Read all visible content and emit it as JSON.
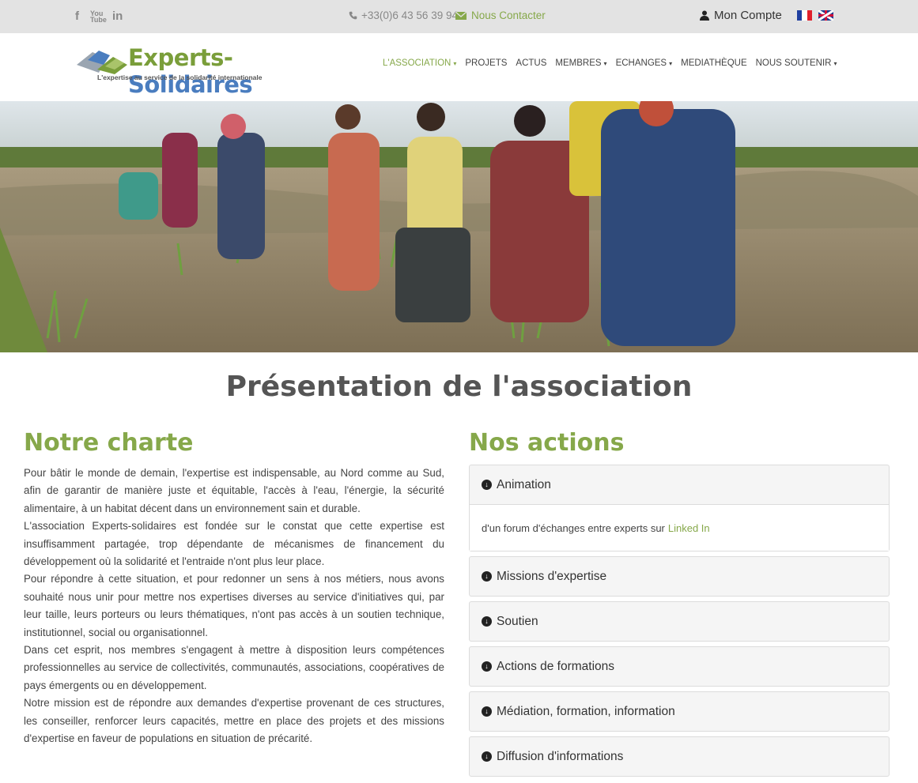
{
  "topbar": {
    "social": [
      {
        "icon": "facebook-icon",
        "glyph": "f"
      },
      {
        "icon": "youtube-icon",
        "glyph": "You Tube"
      },
      {
        "icon": "linkedin-icon",
        "glyph": "in"
      }
    ],
    "phone_icon": "phone-icon",
    "phone": "+33(0)6 43 56 39 94",
    "contact_icon": "envelope-icon",
    "contact": "Nous Contacter",
    "account_icon": "user-icon",
    "account": "Mon Compte",
    "flags": [
      "flag-fr-icon",
      "flag-uk-icon"
    ]
  },
  "header": {
    "logo_title_1": "Experts-",
    "logo_title_2": "Solidaires",
    "logo_subtitle": "L'expertise au service de la solidarité internationale",
    "nav": [
      {
        "label": "L'ASSOCIATION",
        "dropdown": true,
        "active": true
      },
      {
        "label": "PROJETS",
        "dropdown": false,
        "active": false
      },
      {
        "label": "ACTUS",
        "dropdown": false,
        "active": false
      },
      {
        "label": "MEMBRES",
        "dropdown": true,
        "active": false
      },
      {
        "label": "ECHANGES",
        "dropdown": true,
        "active": false
      },
      {
        "label": "MEDIATHÈQUE",
        "dropdown": false,
        "active": false
      },
      {
        "label": "NOUS SOUTENIR",
        "dropdown": true,
        "active": false
      }
    ],
    "chevron": "⌄"
  },
  "main": {
    "title": "Présentation de l'association",
    "charte": {
      "heading": "Notre charte",
      "paragraphs": [
        "Pour bâtir le monde de demain, l'expertise est indispensable, au Nord comme au Sud, afin de garantir de manière juste et équitable, l'accès à l'eau, l'énergie, la sécurité alimentaire, à un habitat décent dans un environnement sain et durable.",
        "L'association Experts-solidaires est fondée sur le constat que cette expertise est insuffisamment partagée, trop dépendante de mécanismes de financement du développement où la solidarité et l'entraide n'ont plus leur place.",
        "Pour répondre à cette situation, et pour redonner un sens à nos métiers, nous avons souhaité nous unir pour mettre nos expertises diverses au service d'initiatives qui, par leur taille, leurs porteurs ou leurs thématiques, n'ont pas accès à un soutien technique, institutionnel, social ou organisationnel.",
        "Dans cet esprit, nos membres s'engagent à mettre à disposition leurs compétences professionnelles au service de collectivités, communautés, associations, coopératives de pays émergents ou en développement.",
        "Notre mission est de répondre aux demandes d'expertise provenant de ces structures, les conseiller, renforcer leurs capacités, mettre en place des projets et des missions d'expertise en faveur de populations en situation de précarité."
      ]
    },
    "actions": {
      "heading": "Nos actions",
      "expanded_body_text": "d'un forum d'échanges entre experts sur",
      "expanded_body_link": "Linked In",
      "items": [
        {
          "label": "Animation",
          "expanded": true
        },
        {
          "label": "Missions d'expertise",
          "expanded": false
        },
        {
          "label": "Soutien",
          "expanded": false
        },
        {
          "label": "Actions de formations",
          "expanded": false
        },
        {
          "label": "Médiation, formation, information",
          "expanded": false
        },
        {
          "label": "Diffusion d'informations",
          "expanded": false
        }
      ]
    }
  },
  "colors": {
    "accent_green": "#86a84a",
    "logo_blue": "#4a7dbf",
    "topbar_bg": "#e3e3e3",
    "panel_bg": "#f5f5f5"
  }
}
